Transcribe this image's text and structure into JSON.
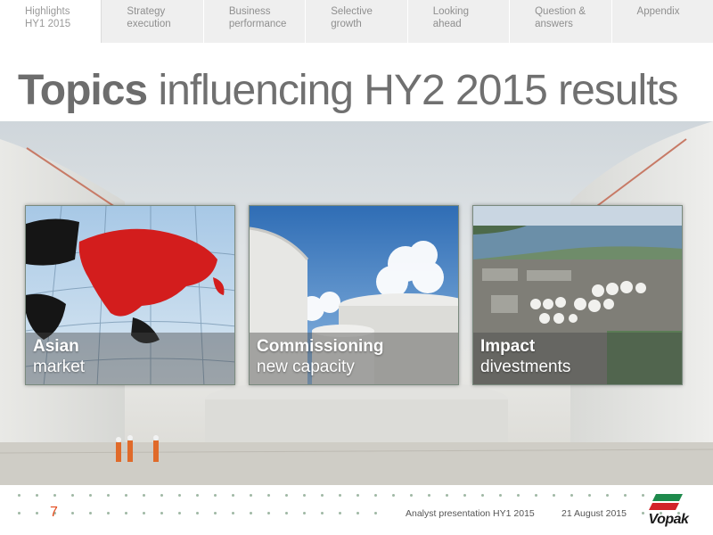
{
  "nav": {
    "items": [
      {
        "line1": "Highlights",
        "line2": "HY1 2015"
      },
      {
        "line1": "Strategy",
        "line2": "execution"
      },
      {
        "line1": "Business",
        "line2": "performance"
      },
      {
        "line1": "Selective",
        "line2": "growth"
      },
      {
        "line1": "Looking",
        "line2": "ahead"
      },
      {
        "line1": "Question &",
        "line2": "answers"
      },
      {
        "line1": "Appendix",
        "line2": ""
      }
    ]
  },
  "title": {
    "bold": "Topics",
    "rest": " influencing HY2 2015 results"
  },
  "tiles": [
    {
      "line1": "Asian",
      "line2": "market",
      "image": "asia-map-image"
    },
    {
      "line1": "Commissioning",
      "line2": "new capacity",
      "image": "storage-tanks-image"
    },
    {
      "line1": "Impact",
      "line2": "divestments",
      "image": "terminal-aerial-image"
    }
  ],
  "footer": {
    "page_number": "7",
    "presentation": "Analyst presentation HY1 2015",
    "date": "21 August 2015",
    "logo_text": "Vopak"
  },
  "colors": {
    "accent": "#e34a1c",
    "nav_bg": "#efefef",
    "title": "#707070",
    "logo_green": "#1e8a4c",
    "logo_red": "#d2232a"
  }
}
